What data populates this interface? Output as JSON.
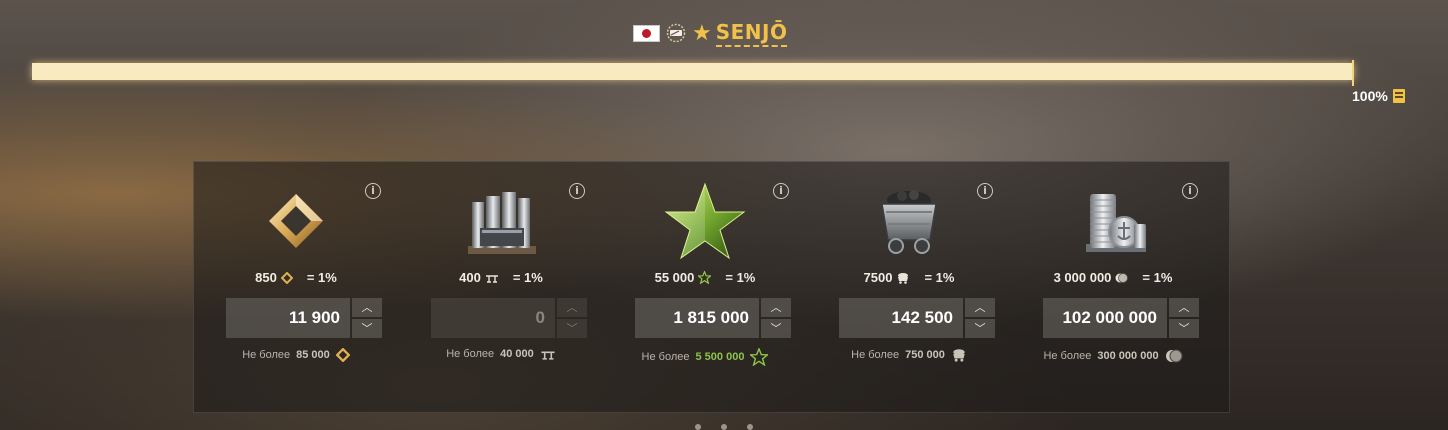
{
  "header": {
    "ship_name": "SENJŌ",
    "flag_icon": "japan-flag-icon",
    "class_icon": "battleship-class-icon",
    "tier_icon": "star-icon",
    "accent_color": "#f2c14a"
  },
  "progress": {
    "value_percent": 100,
    "label": "100%",
    "icon": "document-icon"
  },
  "resources": [
    {
      "name": "elite-commander-xp",
      "icon": "diamond-frame-icon",
      "rate_amount": "850",
      "rate_equals": "= 1%",
      "value": "11 900",
      "disabled": false,
      "limit_label": "Не более",
      "limit_value": "85 000"
    },
    {
      "name": "steel",
      "icon": "steel-beams-icon",
      "rate_amount": "400",
      "rate_equals": "= 1%",
      "value": "0",
      "disabled": true,
      "limit_label": "Не более",
      "limit_value": "40 000"
    },
    {
      "name": "free-xp",
      "icon": "green-star-icon",
      "rate_amount": "55 000",
      "rate_equals": "= 1%",
      "value": "1 815 000",
      "disabled": false,
      "limit_label": "Не более",
      "limit_value": "5 500 000"
    },
    {
      "name": "coal",
      "icon": "coal-cart-icon",
      "rate_amount": "7500",
      "rate_equals": "= 1%",
      "value": "142 500",
      "disabled": false,
      "limit_label": "Не более",
      "limit_value": "750 000"
    },
    {
      "name": "credits",
      "icon": "silver-coins-icon",
      "rate_amount": "3 000 000",
      "rate_equals": "= 1%",
      "value": "102 000 000",
      "disabled": false,
      "limit_label": "Не более",
      "limit_value": "300 000 000"
    }
  ]
}
